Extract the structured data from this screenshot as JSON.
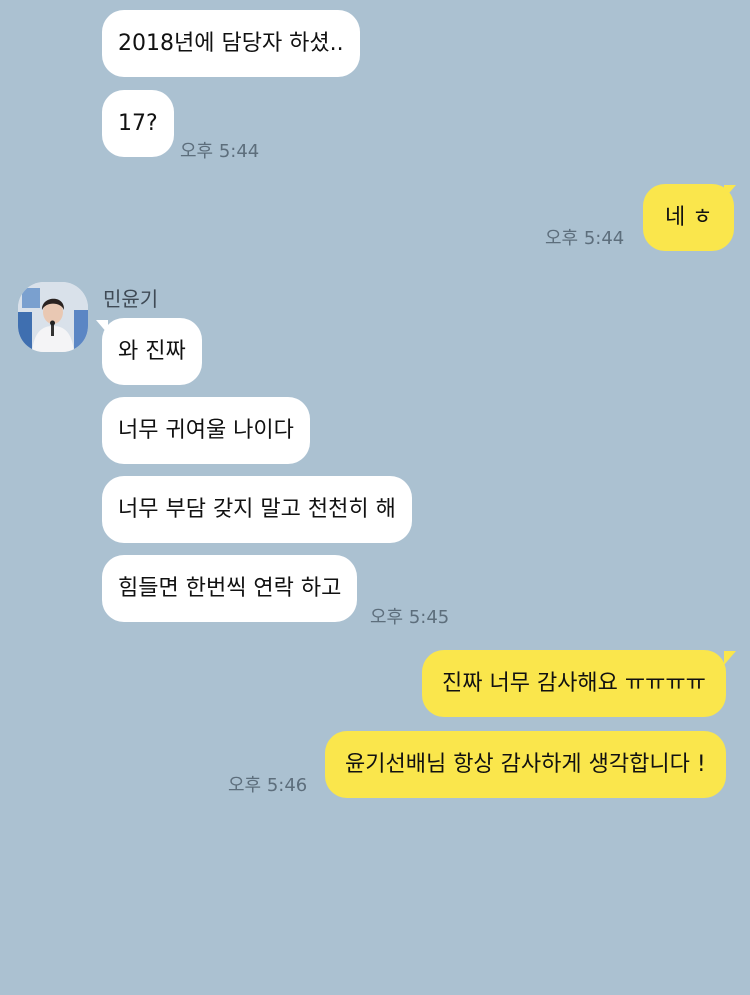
{
  "messages": {
    "m1": {
      "text": "2018년에 담당자 하셨.."
    },
    "m2": {
      "text": "17?",
      "time": "오후 5:44"
    },
    "m3": {
      "text": "네 ㅎ",
      "time": "오후 5:44"
    },
    "sender": {
      "name": "민윤기"
    },
    "m4": {
      "text": "와 진짜"
    },
    "m5": {
      "text": "너무 귀여울 나이다"
    },
    "m6": {
      "text": "너무 부담 갖지 말고 천천히 해"
    },
    "m7": {
      "text": "힘들면 한번씩 연락 하고",
      "time": "오후 5:45"
    },
    "m8": {
      "text": "진짜 너무 감사해요 ㅠㅠㅠㅠ"
    },
    "m9": {
      "text": "윤기선배님 항상 감사하게 생각합니다 !",
      "time": "오후 5:46"
    }
  },
  "colors": {
    "background": "#abc1d1",
    "incoming_bubble": "#ffffff",
    "outgoing_bubble": "#fae64c",
    "timestamp": "#5d6e7c"
  }
}
